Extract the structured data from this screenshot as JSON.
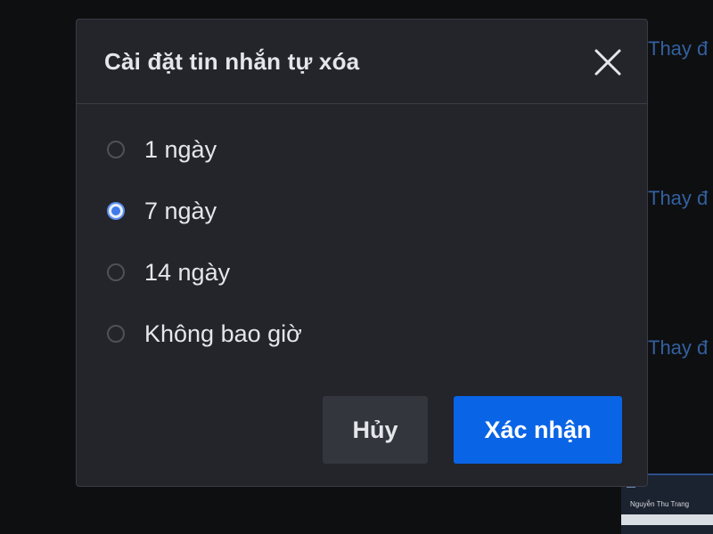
{
  "background": {
    "links": [
      "Thay đ",
      "Thay đ",
      "Thay đ"
    ],
    "thumbnail_text": "Nguyễn Thu Trang"
  },
  "dialog": {
    "title": "Cài đặt tin nhắn tự xóa",
    "close_icon": "close-icon",
    "options": [
      {
        "label": "1 ngày",
        "selected": false
      },
      {
        "label": "7 ngày",
        "selected": true
      },
      {
        "label": "14 ngày",
        "selected": false
      },
      {
        "label": "Không bao giờ",
        "selected": false
      }
    ],
    "cancel_label": "Hủy",
    "confirm_label": "Xác nhận"
  },
  "colors": {
    "accent": "#0a64e6",
    "dialog_bg": "#23252b",
    "page_bg": "#0e0f11"
  }
}
